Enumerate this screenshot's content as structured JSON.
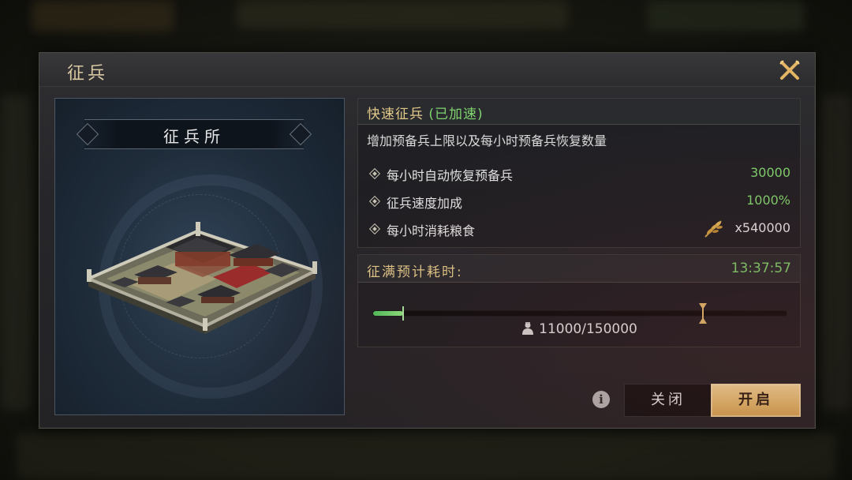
{
  "dialog": {
    "title": "征兵",
    "close_icon": "close-x-icon"
  },
  "building": {
    "name": "征兵所"
  },
  "info": {
    "title_main": "快速征兵",
    "title_status": "(已加速)",
    "description": "增加预备兵上限以及每小时预备兵恢复数量",
    "stats": [
      {
        "label": "每小时自动恢复预备兵",
        "value": "30000"
      },
      {
        "label": "征兵速度加成",
        "value": "1000%"
      },
      {
        "label": "每小时消耗粮食",
        "value": "x540000",
        "icon": "grain-icon"
      }
    ]
  },
  "time": {
    "label": "征满预计耗时:",
    "value": "13:37:57",
    "troops": "11000/150000",
    "progress_current": 11000,
    "progress_max": 150000,
    "marker_fraction": 0.797
  },
  "actions": {
    "info_icon": "i",
    "close_label": "关闭",
    "open_label": "开启"
  },
  "colors": {
    "accent_gold": "#e2c98a",
    "value_green": "#7fd36e",
    "button_gold": "#e7c071"
  }
}
